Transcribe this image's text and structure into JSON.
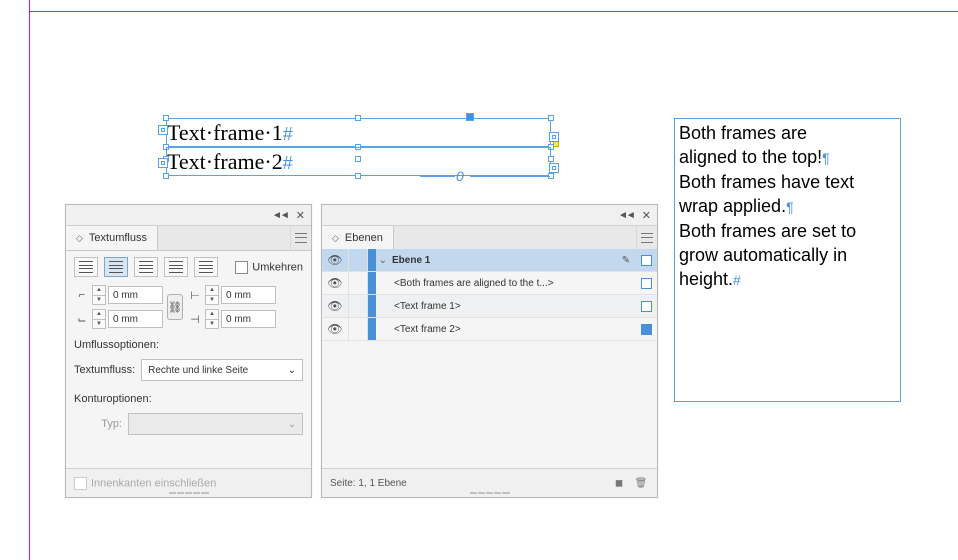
{
  "canvas": {
    "frame1_text": "Text·frame·1",
    "frame1_end": "#",
    "frame2_text": "Text·frame·2",
    "frame2_end": "#",
    "ref_marker": "0"
  },
  "description": {
    "line1": "Both frames are",
    "line2": "aligned to the top!",
    "line2_mark": "¶",
    "line3": "Both frames have text",
    "line4": "wrap applied.",
    "line4_mark": "¶",
    "line5": "Both frames are set to",
    "line6": "grow automatically in",
    "line7": "height.",
    "line7_mark": "#"
  },
  "wrap_panel": {
    "title": "Textumfluss",
    "invert_label": "Umkehren",
    "offset": {
      "top": "0 mm",
      "bottom": "0 mm",
      "left": "0 mm",
      "right": "0 mm"
    },
    "options_label": "Umflussoptionen:",
    "wrap_to_label": "Textumfluss:",
    "wrap_to_value": "Rechte und linke Seite",
    "contour_label": "Konturoptionen:",
    "type_label": "Typ:",
    "include_inside": "Innenkanten einschließen"
  },
  "layers_panel": {
    "title": "Ebenen",
    "rows": [
      {
        "name": "Ebene 1",
        "filled": false,
        "top": true,
        "pen": true
      },
      {
        "name": "<Both frames are aligned to the t...>",
        "filled": false
      },
      {
        "name": "<Text frame 1>",
        "filled": false
      },
      {
        "name": "<Text frame 2>",
        "filled": true
      }
    ],
    "footer": "Seite: 1, 1 Ebene"
  }
}
